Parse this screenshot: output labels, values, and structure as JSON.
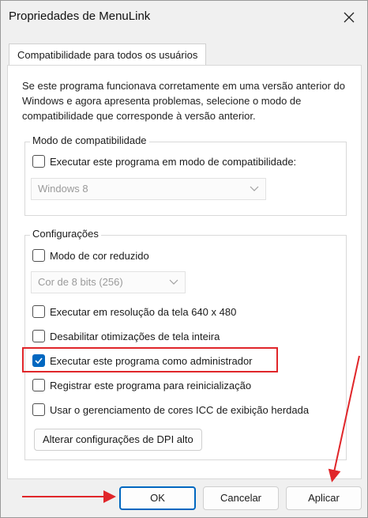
{
  "window": {
    "title": "Propriedades de MenuLink"
  },
  "tabs": [
    {
      "label": "Compatibilidade para todos os usuários"
    }
  ],
  "description": "Se este programa funcionava corretamente em uma versão anterior do Windows e agora apresenta problemas, selecione o modo de compatibilidade que corresponde à versão anterior.",
  "compat_mode": {
    "group_label": "Modo de compatibilidade",
    "checkbox_label": "Executar este programa em modo de compatibilidade:",
    "checked": false,
    "os_select": "Windows 8"
  },
  "settings": {
    "group_label": "Configurações",
    "reduced_color": {
      "label": "Modo de cor reduzido",
      "checked": false
    },
    "color_select": "Cor de 8 bits (256)",
    "items": [
      {
        "label": "Executar em resolução da tela 640 x 480",
        "checked": false
      },
      {
        "label": "Desabilitar otimizações de tela inteira",
        "checked": false
      },
      {
        "label": "Executar este programa como administrador",
        "checked": true
      },
      {
        "label": "Registrar este programa para reinicialização",
        "checked": false
      },
      {
        "label": "Usar o gerenciamento de cores ICC de exibição herdada",
        "checked": false
      }
    ],
    "dpi_button": "Alterar configurações de DPI alto"
  },
  "footer": {
    "ok": "OK",
    "cancel": "Cancelar",
    "apply": "Aplicar"
  },
  "colors": {
    "accent": "#0067c0",
    "annotation": "#e0262a"
  }
}
